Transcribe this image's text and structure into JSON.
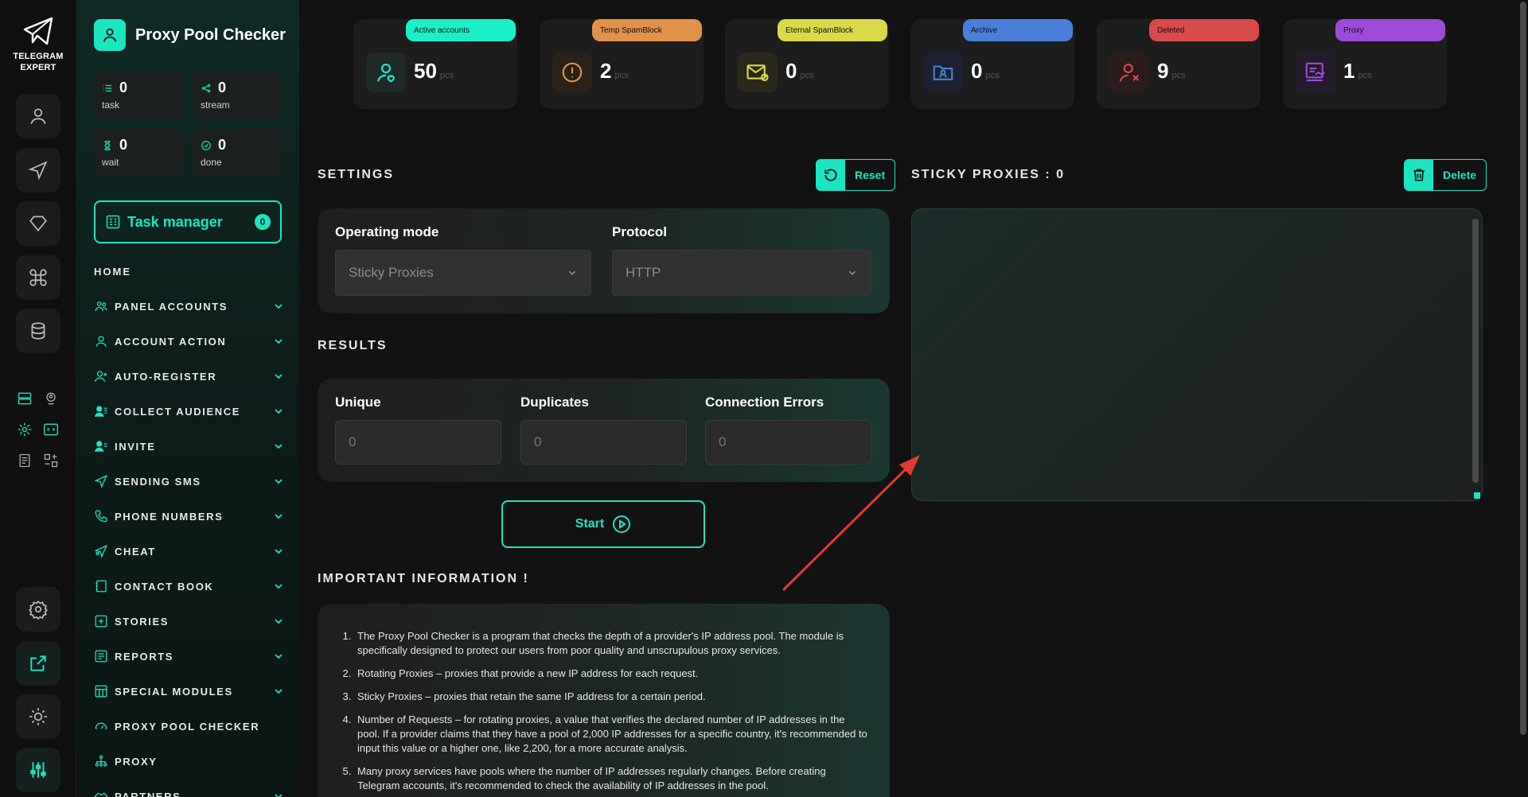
{
  "app": {
    "logo_text_line1": "TELEGRAM",
    "logo_text_line2": "EXPERT",
    "title": "Proxy Pool Checker"
  },
  "stats": [
    {
      "value": "0",
      "label": "task",
      "icon": "list-icon"
    },
    {
      "value": "0",
      "label": "stream",
      "icon": "share-icon"
    },
    {
      "value": "0",
      "label": "wait",
      "icon": "hourglass-icon"
    },
    {
      "value": "0",
      "label": "done",
      "icon": "check-circle-icon"
    }
  ],
  "task_manager": {
    "label": "Task manager",
    "count": "0"
  },
  "nav": {
    "home": "HOME",
    "items": [
      {
        "label": "PANEL ACCOUNTS",
        "icon": "users-icon",
        "expandable": true
      },
      {
        "label": "ACCOUNT ACTION",
        "icon": "user-icon",
        "expandable": true
      },
      {
        "label": "AUTO-REGISTER",
        "icon": "user-plus-icon",
        "expandable": true
      },
      {
        "label": "COLLECT AUDIENCE",
        "icon": "user-list-icon",
        "expandable": true
      },
      {
        "label": "INVITE",
        "icon": "user-invite-icon",
        "expandable": true
      },
      {
        "label": "SENDING SMS",
        "icon": "send-icon",
        "expandable": true
      },
      {
        "label": "PHONE NUMBERS",
        "icon": "phone-icon",
        "expandable": true
      },
      {
        "label": "CHEAT",
        "icon": "send-heart-icon",
        "expandable": true
      },
      {
        "label": "CONTACT BOOK",
        "icon": "book-icon",
        "expandable": true
      },
      {
        "label": "STORIES",
        "icon": "plus-square-icon",
        "expandable": true
      },
      {
        "label": "REPORTS",
        "icon": "report-icon",
        "expandable": true
      },
      {
        "label": "SPECIAL MODULES",
        "icon": "table-icon",
        "expandable": true
      },
      {
        "label": "PROXY POOL CHECKER",
        "icon": "gauge-icon",
        "expandable": false
      },
      {
        "label": "PROXY",
        "icon": "network-icon",
        "expandable": false
      },
      {
        "label": "PARTNERS",
        "icon": "handshake-icon",
        "expandable": true
      }
    ]
  },
  "accounts": [
    {
      "label": "Active accounts",
      "value": "50",
      "unit": "pcs",
      "color": "#19f0c8",
      "icon": "user-heart-icon"
    },
    {
      "label": "Temp SpamBlock",
      "value": "2",
      "unit": "pcs",
      "color": "#e0924a",
      "icon": "alert-circle-icon"
    },
    {
      "label": "Eternal SpamBlock",
      "value": "0",
      "unit": "pcs",
      "color": "#d9d94a",
      "icon": "mail-block-icon"
    },
    {
      "label": "Archive",
      "value": "0",
      "unit": "pcs",
      "color": "#4a7fd9",
      "icon": "folder-user-icon"
    },
    {
      "label": "Deleted",
      "value": "9",
      "unit": "pcs",
      "color": "#d94a4a",
      "icon": "user-x-icon"
    },
    {
      "label": "Proxy",
      "value": "1",
      "unit": "pcs",
      "color": "#9d4ad9",
      "icon": "proxy-icon"
    }
  ],
  "settings": {
    "title": "SETTINGS",
    "reset_label": "Reset",
    "operating_mode_label": "Operating mode",
    "operating_mode_value": "Sticky Proxies",
    "protocol_label": "Protocol",
    "protocol_value": "HTTP"
  },
  "results": {
    "title": "RESULTS",
    "unique_label": "Unique",
    "unique_value": "0",
    "duplicates_label": "Duplicates",
    "duplicates_value": "0",
    "errors_label": "Connection Errors",
    "errors_value": "0"
  },
  "start_label": "Start",
  "info": {
    "title": "IMPORTANT INFORMATION !",
    "items": [
      "The Proxy Pool Checker is a program that checks the depth of a provider's IP address pool. The module is specifically designed to protect our users from poor quality and unscrupulous proxy services.",
      "Rotating Proxies – proxies that provide a new IP address for each request.",
      "Sticky Proxies – proxies that retain the same IP address for a certain period.",
      "Number of Requests – for rotating proxies, a value that verifies the declared number of IP addresses in the pool. If a provider claims that they have a pool of 2,000 IP addresses for a specific country, it's recommended to input this value or a higher one, like 2,200, for a more accurate analysis.",
      "Many proxy services have pools where the number of IP addresses regularly changes. Before creating Telegram accounts, it's recommended to check the availability of IP addresses in the pool."
    ]
  },
  "sticky": {
    "title": "STICKY PROXIES : 0",
    "delete_label": "Delete"
  },
  "colors": {
    "accent": "#19e6c1",
    "annotation_arrow": "#e03a32"
  }
}
